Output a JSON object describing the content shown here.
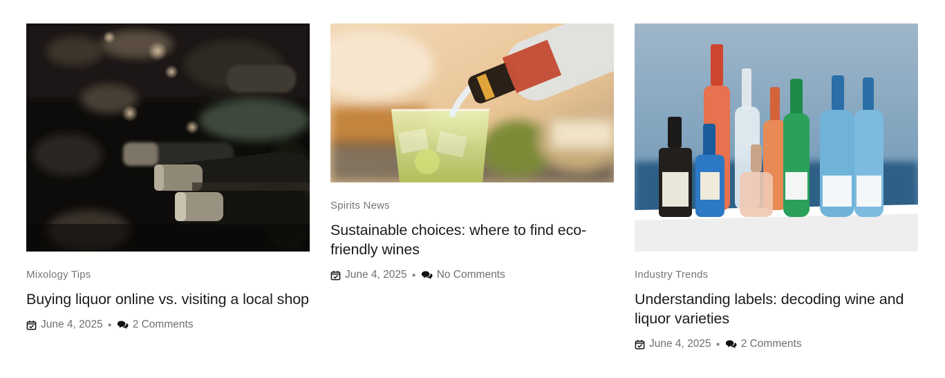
{
  "posts": [
    {
      "category": "Mixology Tips",
      "title": "Buying liquor online vs. visiting a local shop",
      "date": "June 4, 2025",
      "comments": "2 Comments",
      "image": "wine-bottles-rack-photo"
    },
    {
      "category": "Spirits News",
      "title": "Sustainable choices: where to find eco-friendly wines",
      "date": "June 4, 2025",
      "comments": "No Comments",
      "image": "pouring-cocktail-photo"
    },
    {
      "category": "Industry Trends",
      "title": "Understanding labels: decoding wine and liquor varieties",
      "date": "June 4, 2025",
      "comments": "2 Comments",
      "image": "assorted-bottles-photo"
    }
  ],
  "icons": {
    "date": "calendar-check-icon",
    "comments": "comments-icon"
  },
  "colors": {
    "meta_text": "#6f6f6f",
    "category_text": "#767676",
    "title_text": "#1b1b1b"
  }
}
